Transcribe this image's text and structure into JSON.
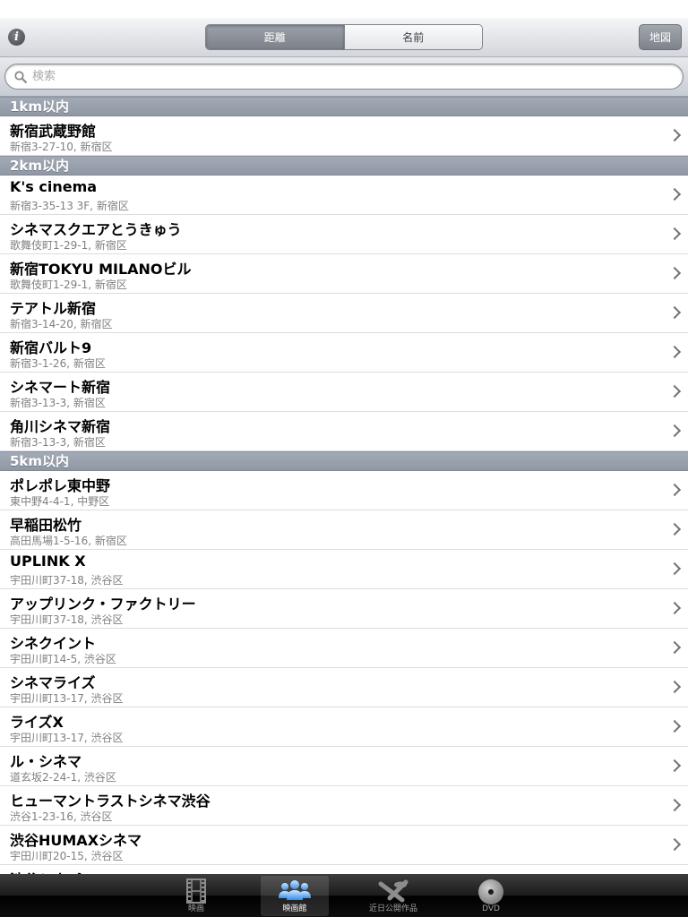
{
  "navbar": {
    "segments": [
      "距離",
      "名前"
    ],
    "selected_segment": "距離",
    "map_button": "地図"
  },
  "search": {
    "placeholder": "検索",
    "value": ""
  },
  "sections": [
    {
      "header": "1km以内",
      "rows": [
        {
          "name": "新宿武蔵野館",
          "address": "新宿3-27-10, 新宿区"
        }
      ]
    },
    {
      "header": "2km以内",
      "rows": [
        {
          "name": "K's cinema",
          "address": "新宿3-35-13 3F, 新宿区"
        },
        {
          "name": "シネマスクエアとうきゅう",
          "address": "歌舞伎町1-29-1, 新宿区"
        },
        {
          "name": "新宿TOKYU MILANOビル",
          "address": "歌舞伎町1-29-1, 新宿区"
        },
        {
          "name": "テアトル新宿",
          "address": "新宿3-14-20, 新宿区"
        },
        {
          "name": "新宿バルト9",
          "address": "新宿3-1-26, 新宿区"
        },
        {
          "name": "シネマート新宿",
          "address": "新宿3-13-3, 新宿区"
        },
        {
          "name": "角川シネマ新宿",
          "address": "新宿3-13-3, 新宿区"
        }
      ]
    },
    {
      "header": "5km以内",
      "rows": [
        {
          "name": "ポレポレ東中野",
          "address": "東中野4-4-1, 中野区"
        },
        {
          "name": "早稲田松竹",
          "address": "高田馬場1-5-16, 新宿区"
        },
        {
          "name": "UPLINK X",
          "address": "宇田川町37-18, 渋谷区"
        },
        {
          "name": "アップリンク・ファクトリー",
          "address": "宇田川町37-18, 渋谷区"
        },
        {
          "name": "シネクイント",
          "address": "宇田川町14-5, 渋谷区"
        },
        {
          "name": "シネマライズ",
          "address": "宇田川町13-17, 渋谷区"
        },
        {
          "name": "ライズX",
          "address": "宇田川町13-17, 渋谷区"
        },
        {
          "name": "ル・シネマ",
          "address": "道玄坂2-24-1, 渋谷区"
        },
        {
          "name": "ヒューマントラストシネマ渋谷",
          "address": "渋谷1-23-16, 渋谷区"
        },
        {
          "name": "渋谷HUMAXシネマ",
          "address": "宇田川町20-15, 渋谷区"
        },
        {
          "name": "渋谷シネパレス",
          "address": ""
        }
      ]
    }
  ],
  "tabbar": {
    "tabs": [
      {
        "label": "映画",
        "icon": "film-icon"
      },
      {
        "label": "映画館",
        "icon": "people-icon"
      },
      {
        "label": "近日公開作品",
        "icon": "clapper-icon"
      },
      {
        "label": "DVD",
        "icon": "disc-icon"
      }
    ],
    "selected": "映画館"
  }
}
